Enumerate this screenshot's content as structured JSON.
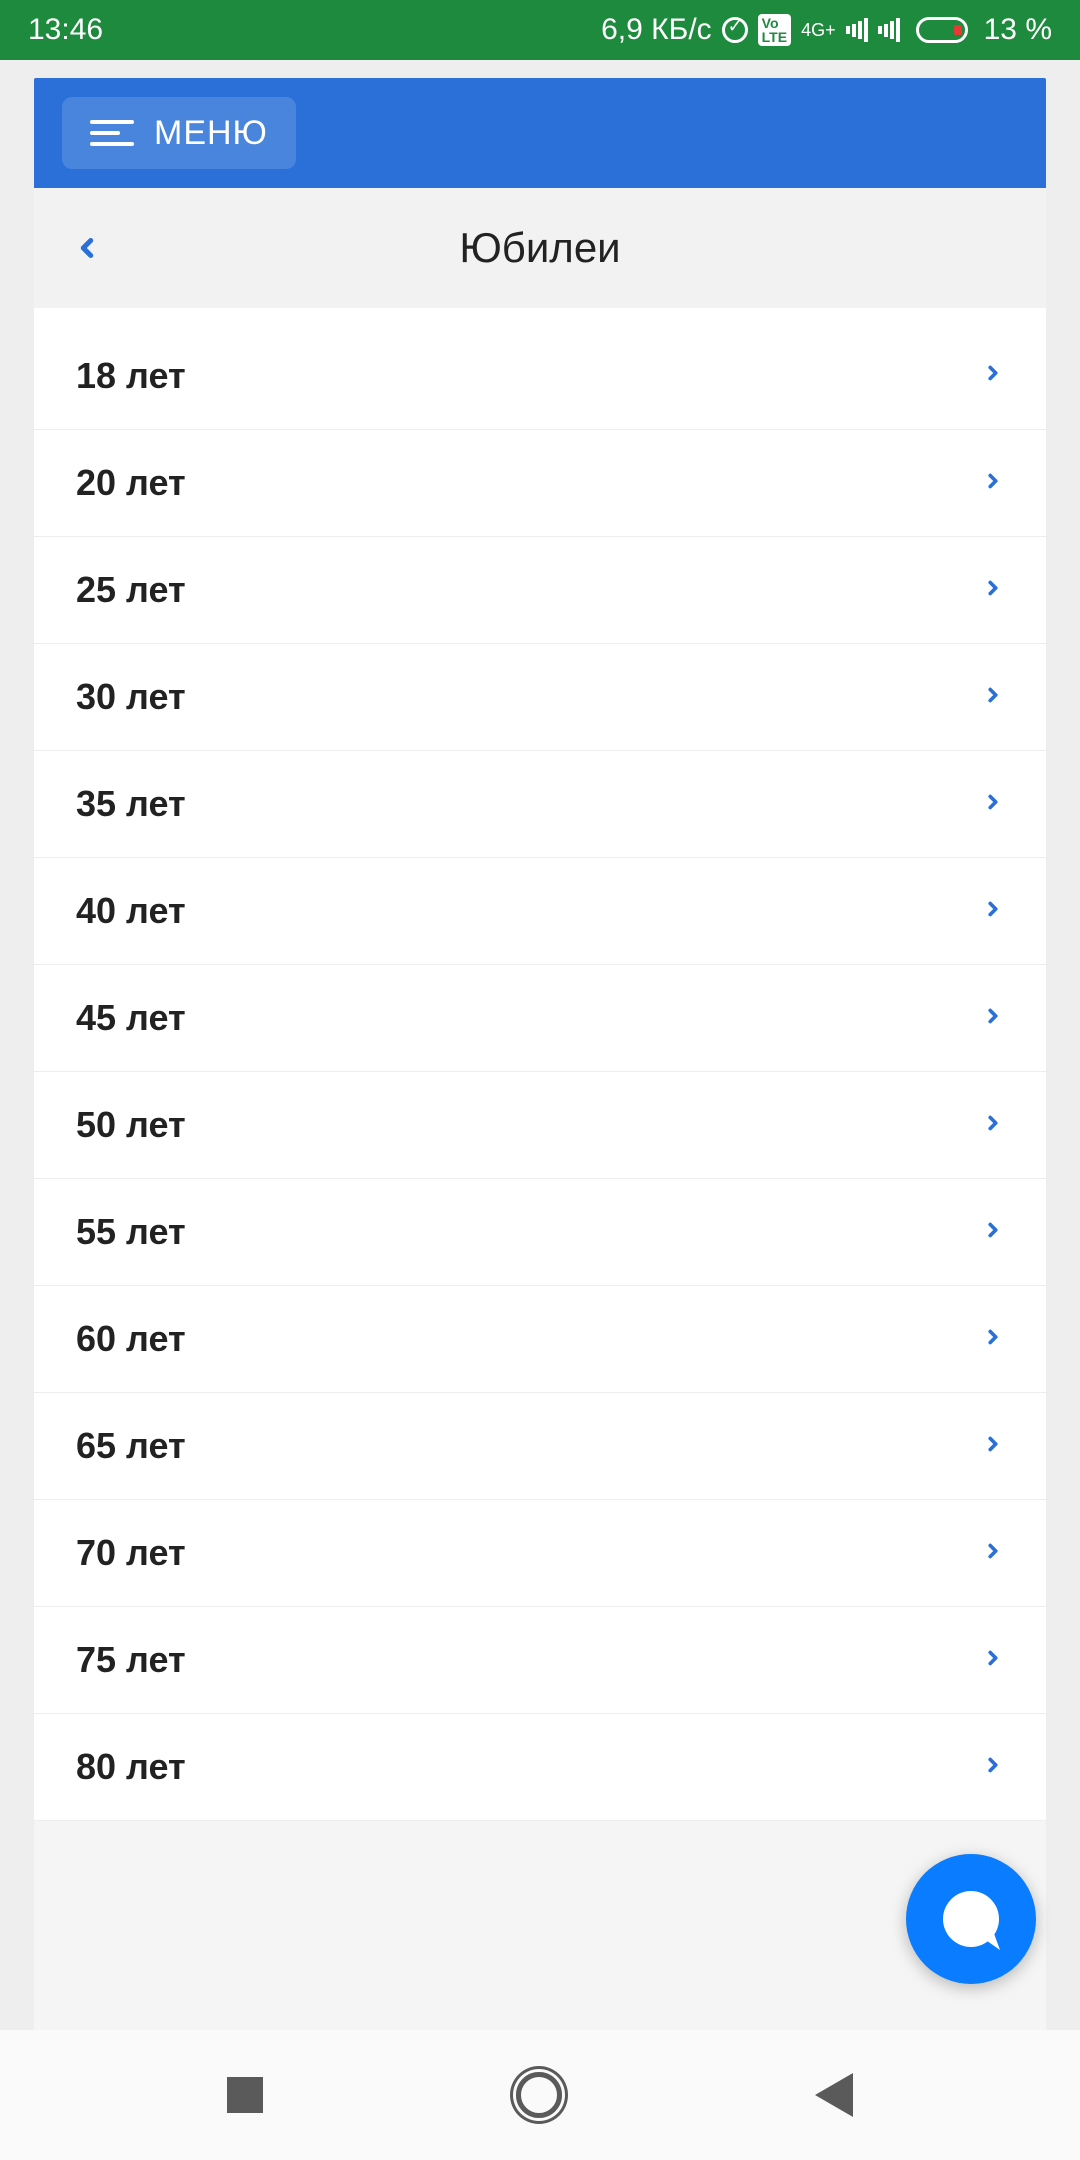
{
  "status": {
    "time": "13:46",
    "speed": "6,9 КБ/с",
    "network_label": "4G+",
    "volte": "Vo LTE",
    "battery_pct": "13 %"
  },
  "header": {
    "menu_label": "МЕНЮ"
  },
  "page": {
    "title": "Юбилеи"
  },
  "list": {
    "items": [
      {
        "label": "18 лет"
      },
      {
        "label": "20 лет"
      },
      {
        "label": "25 лет"
      },
      {
        "label": "30 лет"
      },
      {
        "label": "35 лет"
      },
      {
        "label": "40 лет"
      },
      {
        "label": "45 лет"
      },
      {
        "label": "50 лет"
      },
      {
        "label": "55 лет"
      },
      {
        "label": "60 лет"
      },
      {
        "label": "65 лет"
      },
      {
        "label": "70 лет"
      },
      {
        "label": "75 лет"
      },
      {
        "label": "80 лет"
      }
    ]
  }
}
